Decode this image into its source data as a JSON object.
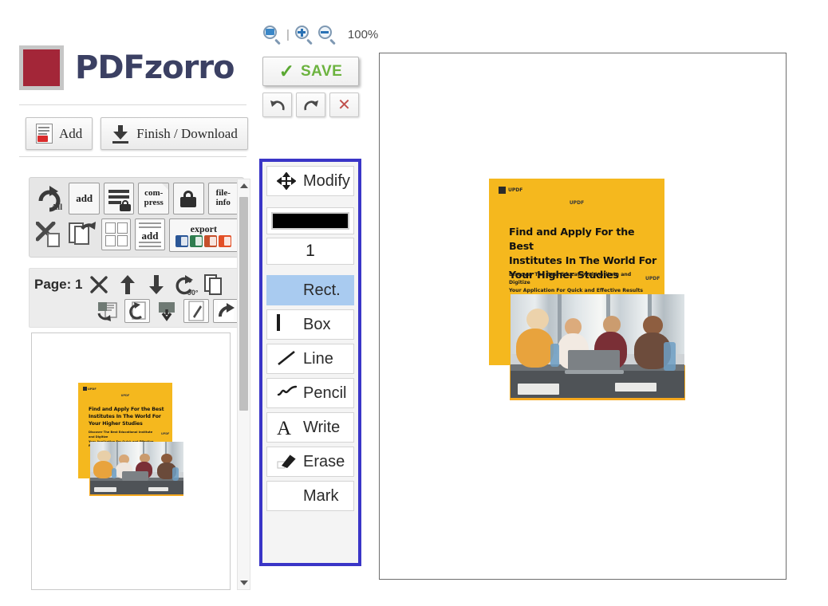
{
  "brand": {
    "name": "PDFzorro",
    "logo_color": "#a32638"
  },
  "top_actions": [
    {
      "id": "add",
      "label": "Add",
      "icon": "pdf-document-icon"
    },
    {
      "id": "finish_download",
      "label": "Finish / Download",
      "icon": "download-icon"
    }
  ],
  "function_toolbar": {
    "close_label": "X",
    "row1": [
      {
        "id": "reload-all",
        "label": "All",
        "icon": "rotate-all-icon"
      },
      {
        "id": "add-page",
        "label": "add",
        "icon": "add-page-icon"
      },
      {
        "id": "protect-pages",
        "label": "",
        "icon": "secure-pages-icon"
      },
      {
        "id": "compress",
        "label": "com-press",
        "label_line1": "com-",
        "label_line2": "press",
        "icon": "compress-icon"
      },
      {
        "id": "lock",
        "label": "",
        "icon": "lock-icon"
      },
      {
        "id": "file-info",
        "label": "file-info",
        "label_line1": "file-",
        "label_line2": "info",
        "icon": "file-info-icon"
      }
    ],
    "row2": [
      {
        "id": "delete-pages",
        "label": "",
        "icon": "delete-pages-icon"
      },
      {
        "id": "copy-pages",
        "label": "",
        "icon": "copy-pages-icon"
      },
      {
        "id": "arrange-pages",
        "label": "",
        "icon": "grid-pages-icon"
      },
      {
        "id": "add-text",
        "label": "add",
        "icon": "add-text-page-icon"
      },
      {
        "id": "export",
        "label": "export",
        "icon": "export-icon",
        "formats": [
          {
            "name": "word",
            "color": "#2b5797"
          },
          {
            "name": "excel",
            "color": "#2f7d4f"
          },
          {
            "name": "powerpoint",
            "color": "#c5502c"
          },
          {
            "name": "html5",
            "color": "#e34f26"
          }
        ]
      }
    ]
  },
  "page_controls": {
    "page_label": "Page: 1",
    "row1": [
      {
        "id": "delete-page",
        "icon": "x-icon"
      },
      {
        "id": "move-up",
        "icon": "arrow-up-icon"
      },
      {
        "id": "move-down",
        "icon": "arrow-down-icon"
      },
      {
        "id": "rotate-90",
        "icon": "rotate-90-icon",
        "caption": "90°"
      },
      {
        "id": "duplicate-page",
        "icon": "copy-icon"
      }
    ],
    "row2": [
      {
        "id": "extract-page",
        "icon": "extract-page-icon"
      },
      {
        "id": "rotate-page",
        "icon": "rotate-page-icon"
      },
      {
        "id": "download-page",
        "icon": "download-page-icon"
      },
      {
        "id": "edit-page",
        "icon": "edit-page-icon"
      },
      {
        "id": "redo-page",
        "icon": "redo-page-icon"
      }
    ]
  },
  "thumbnail_scrollbar": {
    "up": "scroll-up-arrow",
    "down": "scroll-down-arrow"
  },
  "zoom_bar": {
    "fit_label": "fit-page-icon",
    "zoom_in_label": "zoom-in-icon",
    "zoom_out_label": "zoom-out-icon",
    "value": "100%"
  },
  "save": {
    "label": "SAVE",
    "check": "✓"
  },
  "history": [
    {
      "id": "undo",
      "icon": "undo-icon",
      "glyph": "↰"
    },
    {
      "id": "redo",
      "icon": "redo-icon",
      "glyph": "↱"
    },
    {
      "id": "cancel",
      "icon": "close-icon",
      "glyph": "✕"
    }
  ],
  "tools_panel": {
    "accent_color": "#3a35c7",
    "modify": {
      "label": "Modify",
      "icon": "move-arrows-icon"
    },
    "color_value": "#000000",
    "thickness_value": "1",
    "items": [
      {
        "id": "rect",
        "label": "Rect.",
        "icon": "filled-rect-icon",
        "selected": true
      },
      {
        "id": "box",
        "label": "Box",
        "icon": "outline-rect-icon",
        "selected": false
      },
      {
        "id": "line",
        "label": "Line",
        "icon": "line-icon",
        "selected": false
      },
      {
        "id": "pencil",
        "label": "Pencil",
        "icon": "pencil-icon",
        "selected": false
      },
      {
        "id": "write",
        "label": "Write",
        "icon": "text-a-icon",
        "selected": false
      },
      {
        "id": "erase",
        "label": "Erase",
        "icon": "eraser-icon",
        "selected": false
      },
      {
        "id": "mark",
        "label": "Mark",
        "icon": "highlighter-icon",
        "selected": false
      }
    ]
  },
  "document": {
    "brand_tag": "UPDF",
    "top_center_tag": "UPDF",
    "side_tag": "UPDF",
    "title": "Find and Apply For the Best Institutes In The World For Your Higher Studies",
    "title_lines": [
      "Find and Apply For the Best",
      "Institutes In The World For",
      "Your Higher Studies"
    ],
    "subtitle_lines": [
      "Discover The Best Educational Institute and Digitize",
      "Your Application For Quick and Effective Results"
    ],
    "accent_color": "#f5b81e",
    "photo_alt": "four students studying together with a laptop"
  }
}
